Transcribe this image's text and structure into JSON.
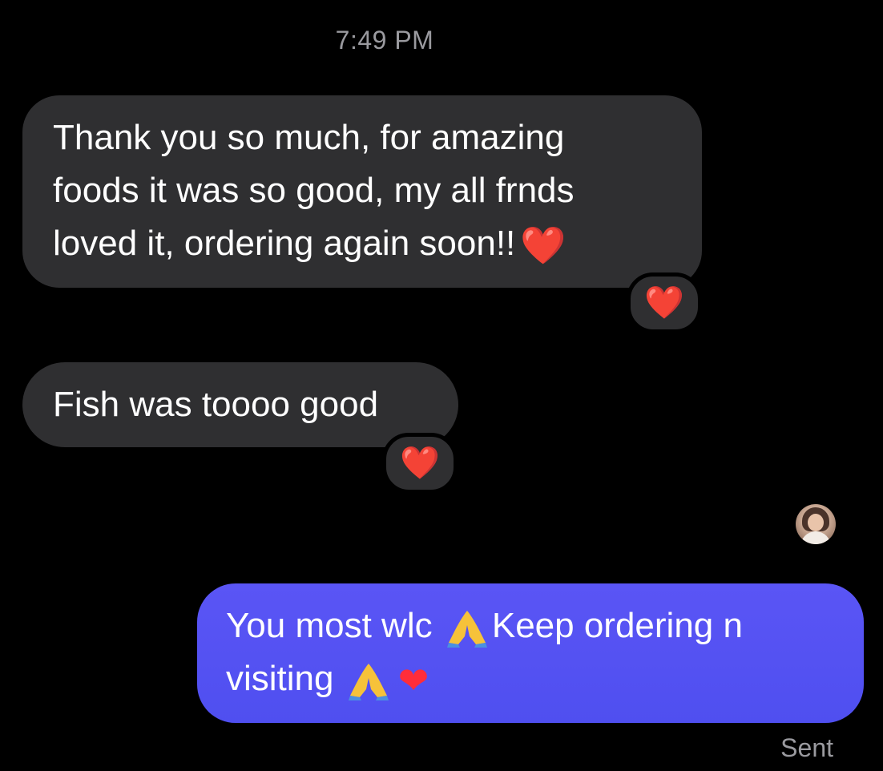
{
  "timestamp": "7:49 PM",
  "messages": [
    {
      "direction": "incoming",
      "lines": [
        "Thank you so much, for amazing",
        "foods it was so good, my all frnds",
        "loved it, ordering again soon!!"
      ],
      "trailing_emoji": "❤️",
      "reaction": "❤️"
    },
    {
      "direction": "incoming",
      "text": "Fish was toooo good",
      "reaction": "❤️"
    },
    {
      "direction": "outgoing",
      "part1": "You most wlc",
      "part2": "Keep ordering n",
      "part3": "visiting",
      "emojis": [
        "pray-icon",
        "pray-icon",
        "heart-icon"
      ]
    }
  ],
  "status": "Sent",
  "colors": {
    "background": "#000000",
    "incoming_bubble": "#2f2f31",
    "outgoing_bubble": "#5a55f5",
    "heart": "#ff2d3a",
    "meta_text": "#9a9a9f"
  }
}
